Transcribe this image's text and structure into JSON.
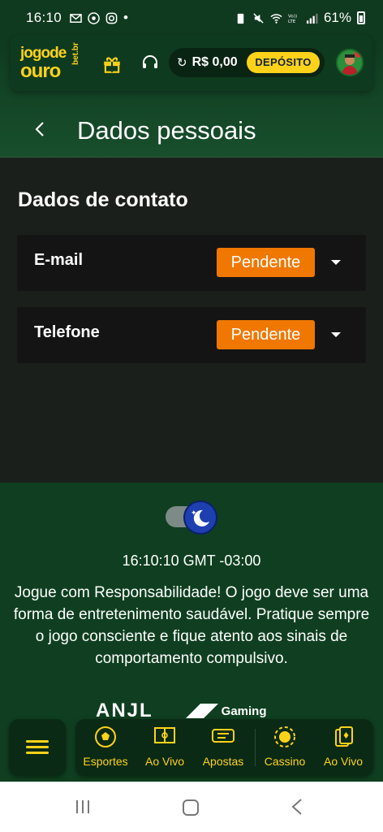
{
  "status_bar": {
    "time": "16:10",
    "dot": "•",
    "battery": "61%",
    "left_icons": [
      "gmail-icon",
      "chrome-icon",
      "instagram-icon"
    ],
    "right_icons": [
      "battery-saver-icon",
      "mute-icon",
      "wifi-icon",
      "volte-icon",
      "signal-icon"
    ]
  },
  "header": {
    "logo_line1": "jogode",
    "logo_line2": "ouro",
    "logo_suffix": "bet.br",
    "balance": "R$ 0,00",
    "deposit_label": "DEPÓSITO",
    "icons": [
      "gift-icon",
      "headset-icon",
      "refresh-icon",
      "avatar"
    ]
  },
  "page": {
    "title": "Dados pessoais",
    "section_title": "Dados de contato",
    "contacts": [
      {
        "label": "E-mail",
        "status": "Pendente"
      },
      {
        "label": "Telefone",
        "status": "Pendente"
      }
    ]
  },
  "footer": {
    "clock": "16:10:10 GMT -03:00",
    "responsibility_text": "Jogue com Responsabilidade! O jogo deve ser uma forma de entretenimento saudável. Pratique sempre o jogo consciente e fique atento aos sinais de comportamento compulsivo.",
    "partner_logos": [
      "ANJL",
      "Gaming"
    ]
  },
  "bottom_nav": {
    "items": [
      {
        "label": "Esportes",
        "icon": "soccer-ball-icon"
      },
      {
        "label": "Ao Vivo",
        "icon": "field-icon"
      },
      {
        "label": "Apostas",
        "icon": "ticket-icon"
      },
      {
        "label": "Cassino",
        "icon": "casino-chip-icon"
      },
      {
        "label": "Ao Vivo",
        "icon": "cards-icon"
      }
    ]
  },
  "colors": {
    "brand_green": "#0f3a1f",
    "accent_yellow": "#ffd21a",
    "pending_orange": "#f07800",
    "card_bg": "#141414"
  }
}
